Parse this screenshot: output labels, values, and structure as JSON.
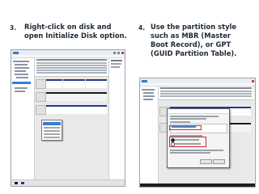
{
  "steps": [
    {
      "number": "3.",
      "lines": [
        "Right-click on disk and",
        "open Initialize Disk option."
      ]
    },
    {
      "number": "4.",
      "lines": [
        "Use the partition style",
        "such as MBR (Master",
        "Boot Record), or GPT",
        "(GUID Partition Table)."
      ]
    }
  ],
  "colors": {
    "text": "#1e2a35",
    "partition_bar": "#1f3c88",
    "highlight": "#3a7bd5",
    "red_box": "#d0282e",
    "taskbar": "#1d1f24"
  },
  "icons": [
    "windows-disk-management-icon"
  ]
}
